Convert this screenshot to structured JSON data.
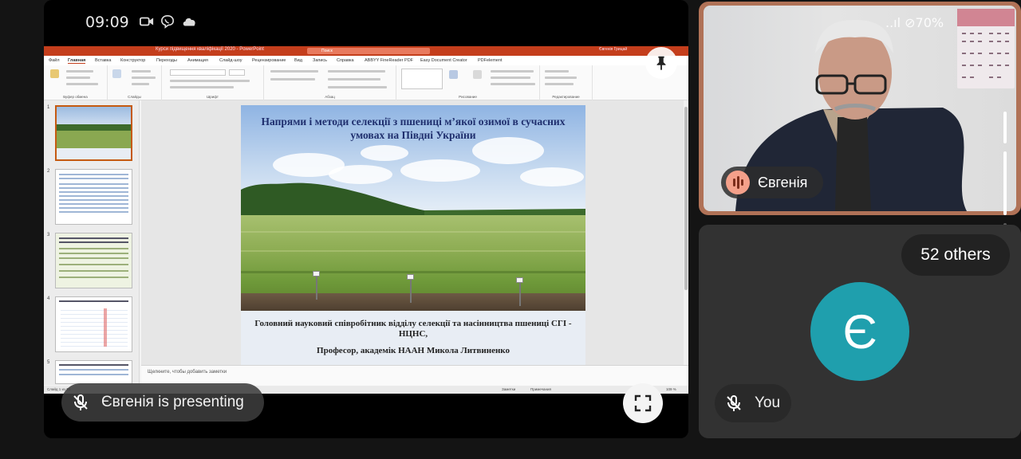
{
  "status_bar": {
    "time": "09:09"
  },
  "presentation": {
    "app_title": "Курси підвищення кваліфікації 2020 - PowerPoint",
    "search_placeholder": "Поиск",
    "user_name": "Євгенія Грицай",
    "menu_tabs": [
      "Файл",
      "Главная",
      "Вставка",
      "Конструктор",
      "Переходы",
      "Анимация",
      "Слайд-шоу",
      "Рецензирование",
      "Вид",
      "Запись",
      "Справка",
      "ABBYY FineReader PDF",
      "Easy Document Creator",
      "PDFelement"
    ],
    "ribbon_groups": [
      "Буфер обмена",
      "Слайды",
      "Шрифт",
      "Абзац",
      "Рисование",
      "Редактирование"
    ],
    "slide_numbers": [
      "1",
      "2",
      "3",
      "4",
      "5"
    ],
    "slide": {
      "title": "Напрями і методи селекції  з пшениці м’якої озимої  в сучасних умовах на Півдні України",
      "author_line1": "Головний науковий співробітник  відділу селекції та насінництва пшениці СГІ - НЦНС,",
      "author_line2": "Професор, академік  НААН Микола Литвиненко"
    },
    "notes_placeholder": "Щелкните, чтобы добавить заметки",
    "status_left": "Слайд 1 из 53",
    "status_notes": "Заметки",
    "status_comments": "Примечания",
    "zoom": "109 %"
  },
  "presenting_label": "Євгенія is presenting",
  "speaker": {
    "name": "Євгенія",
    "status_overlay": "..ıl ⊘70%"
  },
  "self": {
    "others_count": "52 others",
    "avatar_letter": "Є",
    "label": "You"
  },
  "colors": {
    "background": "#141414",
    "speaker_border": "#b07257",
    "avatar": "#1f9fad",
    "powerpoint_red": "#c43e1c"
  },
  "icons": [
    "video-camera-icon",
    "viber-icon",
    "cloud-icon",
    "pin-icon",
    "mic-off-icon",
    "fullscreen-icon",
    "audio-wave-icon"
  ]
}
